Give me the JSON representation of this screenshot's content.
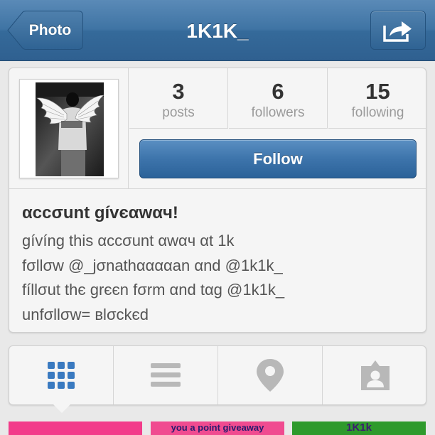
{
  "navbar": {
    "back_label": "Photo",
    "title": "1K1K_",
    "share_icon": "share-arrow-icon"
  },
  "profile": {
    "stats": [
      {
        "value": "3",
        "label": "posts"
      },
      {
        "value": "6",
        "label": "followers"
      },
      {
        "value": "15",
        "label": "following"
      }
    ],
    "follow_label": "Follow",
    "bio": {
      "title": "αccσunt gívєαwαч!",
      "lines": [
        "gívíng this αccσunt αwαч αt 1k",
        "fσllσw @_jσnathααααan αnd @1k1k_",
        "fíllσut thє grєєn fσrm αnd tαg @1k1k_",
        "unfσllσw= вlσckєd"
      ]
    }
  },
  "tabs": [
    {
      "icon": "grid-view-icon",
      "active": true
    },
    {
      "icon": "list-view-icon",
      "active": false
    },
    {
      "icon": "map-pin-icon",
      "active": false
    },
    {
      "icon": "tagged-photos-icon",
      "active": false
    }
  ],
  "thumbnails": [
    {
      "text": ""
    },
    {
      "text": "you a point giveaway"
    },
    {
      "text": "1K1k"
    }
  ],
  "colors": {
    "nav_blue": "#3f74a4",
    "follow_blue": "#3d74ab",
    "active_tab_icon": "#3a7ac0",
    "inactive_icon": "#b8b8b8",
    "thumb_pink": "#f23b8a",
    "thumb_green": "#2e9a2c"
  }
}
